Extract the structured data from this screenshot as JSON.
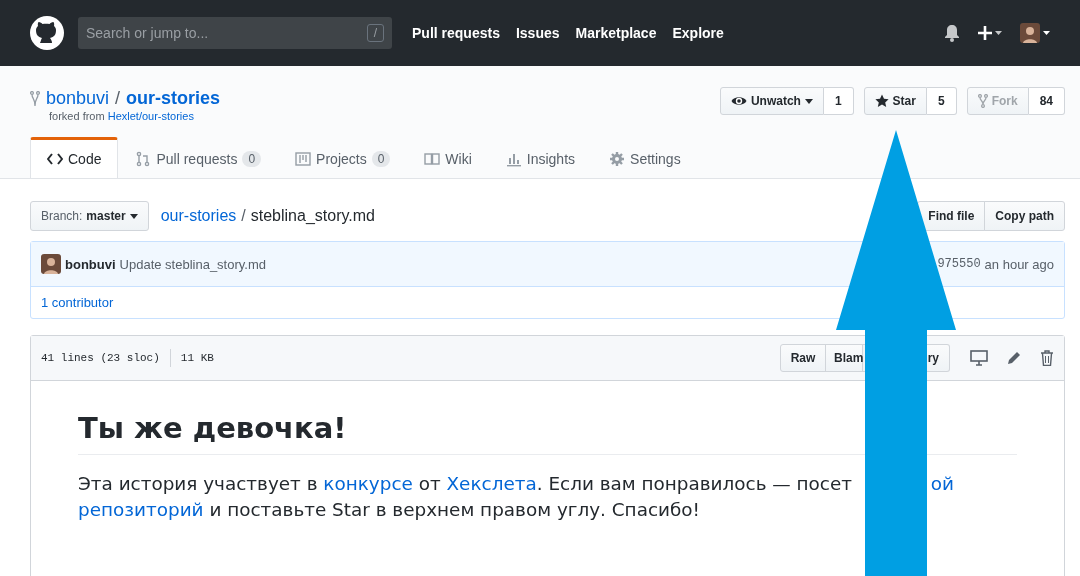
{
  "header": {
    "search_placeholder": "Search or jump to...",
    "slash_key": "/",
    "nav": [
      "Pull requests",
      "Issues",
      "Marketplace",
      "Explore"
    ]
  },
  "repo": {
    "owner": "bonbuvi",
    "separator": "/",
    "name": "our-stories",
    "forked_prefix": "forked from",
    "forked_source": "Hexlet/our-stories",
    "actions": [
      {
        "kind": "watch",
        "label": "Unwatch",
        "count": "1",
        "disabled": false
      },
      {
        "kind": "star",
        "label": "Star",
        "count": "5",
        "disabled": false
      },
      {
        "kind": "fork",
        "label": "Fork",
        "count": "84",
        "disabled": true
      }
    ]
  },
  "tabs": [
    {
      "kind": "code",
      "label": "Code",
      "selected": true
    },
    {
      "kind": "pr",
      "label": "Pull requests",
      "count": "0",
      "selected": false
    },
    {
      "kind": "projects",
      "label": "Projects",
      "count": "0",
      "selected": false
    },
    {
      "kind": "wiki",
      "label": "Wiki",
      "selected": false
    },
    {
      "kind": "insights",
      "label": "Insights",
      "selected": false
    },
    {
      "kind": "settings",
      "label": "Settings",
      "selected": false
    }
  ],
  "file_nav": {
    "branch_label": "Branch:",
    "branch": "master",
    "path_root": "our-stories",
    "separator": "/",
    "file": "steblina_story.md",
    "buttons": [
      "Find file",
      "Copy path"
    ]
  },
  "commit": {
    "author": "bonbuvi",
    "message": "Update steblina_story.md",
    "sha": "975550",
    "time": "an hour ago",
    "contributors": "1 contributor"
  },
  "file": {
    "lines": "41 lines (23 sloc)",
    "size": "11 KB",
    "buttons": [
      "Raw",
      "Blam",
      "ry"
    ],
    "heading": "Ты же девочка!",
    "line_1": [
      {
        "text": "Эта история участвует в ",
        "link": false
      },
      {
        "text": "конкурсе",
        "link": true
      },
      {
        "text": " от ",
        "link": false
      },
      {
        "text": "Хекслета",
        "link": true
      },
      {
        "text": ". Если вам понравилось — посет",
        "link": false
      }
    ],
    "line_1_tail": "ой",
    "line_2": [
      {
        "text": "репозиторий",
        "link": true
      },
      {
        "text": " и поставьте Star в верхнем правом углу. Спасибо!",
        "link": false
      }
    ]
  }
}
